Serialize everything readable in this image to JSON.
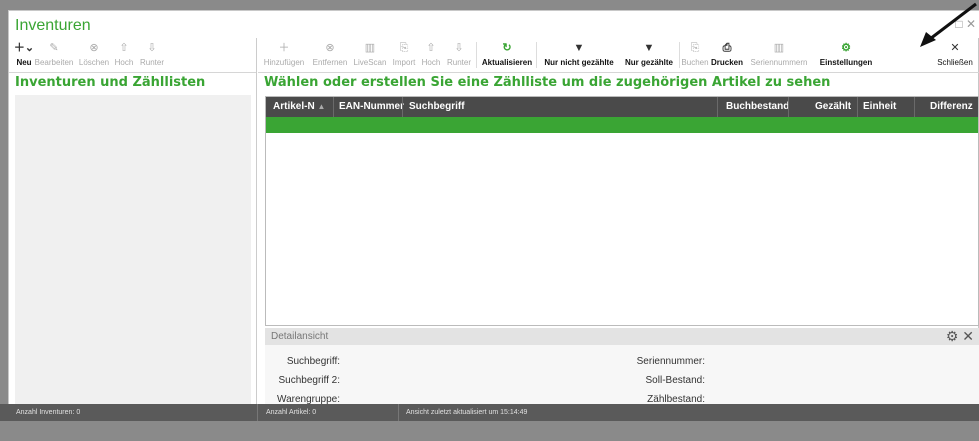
{
  "window": {
    "title": "Inventuren",
    "controls": "□ ✕"
  },
  "left": {
    "toolbar": [
      {
        "label": "Neu",
        "icon": "＋⌄",
        "active": true
      },
      {
        "label": "Bearbeiten",
        "icon": "✎",
        "active": false
      },
      {
        "label": "Löschen",
        "icon": "⊗",
        "active": false
      },
      {
        "label": "Hoch",
        "icon": "⇧",
        "active": false
      },
      {
        "label": "Runter",
        "icon": "⇩",
        "active": false
      }
    ],
    "section_title": "Inventuren und Zähllisten"
  },
  "right": {
    "toolbar": [
      {
        "label": "Hinzufügen",
        "icon": "＋",
        "active": false
      },
      {
        "label": "Entfernen",
        "icon": "⊗",
        "active": false
      },
      {
        "label": "LiveScan",
        "icon": "▥",
        "active": false
      },
      {
        "label": "Import",
        "icon": "⎘",
        "active": false
      },
      {
        "label": "Hoch",
        "icon": "⇧",
        "active": false
      },
      {
        "label": "Runter",
        "icon": "⇩",
        "active": false
      },
      {
        "label": "Aktualisieren",
        "icon": "↻",
        "active": true
      },
      {
        "label": "Nur nicht gezählte",
        "icon": "▼",
        "active": true
      },
      {
        "label": "Nur gezählte",
        "icon": "▼",
        "active": true
      },
      {
        "label": "Buchen",
        "icon": "⎘",
        "active": false
      },
      {
        "label": "Drucken",
        "icon": "⎙",
        "active": true
      },
      {
        "label": "Seriennummern",
        "icon": "▥",
        "active": false
      },
      {
        "label": "Einstellungen",
        "icon": "⚙",
        "active": true
      },
      {
        "label": "Schließen",
        "icon": "✕",
        "active": true
      }
    ],
    "section_title": "Wählen oder erstellen Sie eine Zählliste um die zugehörigen Artikel zu sehen",
    "grid_columns": [
      "Artikel-N",
      "EAN-Nummer",
      "Suchbegriff",
      "Buchbestand",
      "Gezählt",
      "Einheit",
      "Differenz"
    ],
    "sort_indicator": "▲",
    "detail": {
      "title": "Detailansicht",
      "fields_left": [
        "Suchbegriff:",
        "Suchbegriff 2:",
        "Warengruppe:"
      ],
      "fields_right": [
        "Seriennummer:",
        "Soll-Bestand:",
        "Zählbestand:"
      ]
    }
  },
  "status": {
    "left": "Anzahl Inventuren: 0",
    "middle": "Anzahl Artikel: 0",
    "right": "Ansicht zuletzt aktualisiert um 15:14:49"
  },
  "colors": {
    "accent": "#3aa534",
    "grid_header": "#4a4a4a",
    "status_bar": "#5a5a5a"
  }
}
